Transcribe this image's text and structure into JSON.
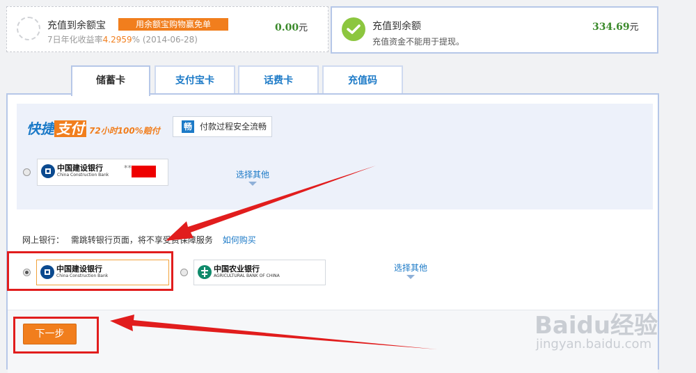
{
  "yuebao_card": {
    "title": "充值到余额宝",
    "promo": "用余额宝购物赢免单",
    "rate_prefix": "7日年化收益率",
    "rate_value": "4.2959",
    "rate_suffix": "% (2014-06-28)",
    "amount": "0.00",
    "unit": "元"
  },
  "balance_card": {
    "title": "充值到余额",
    "subtitle": "充值资金不能用于提现。",
    "amount": "334.69",
    "unit": "元"
  },
  "tabs": [
    {
      "label": "储蓄卡",
      "active": true
    },
    {
      "label": "支付宝卡",
      "active": false
    },
    {
      "label": "话费卡",
      "active": false
    },
    {
      "label": "充值码",
      "active": false
    }
  ],
  "quick_pay": {
    "brand_a": "快捷",
    "brand_b": "支付",
    "guarantee": "72小时100%赔付",
    "secure_icon": "畅",
    "secure_text": "付款过程安全流畅",
    "bank_name": "中国建设银行",
    "bank_en": "China Construction Bank",
    "card_masked": "**",
    "select_other": "选择其他"
  },
  "net_bank": {
    "label": "网上银行：",
    "note": "需跳转银行页面，将不享受",
    "note_tail": "费保障服务",
    "how_buy": "如何购买",
    "banks": [
      {
        "name": "中国建设银行",
        "en": "China Construction Bank",
        "selected": true
      },
      {
        "name": "中国农业银行",
        "en": "AGRICULTURAL BANK OF CHINA",
        "selected": false
      }
    ],
    "select_other": "选择其他"
  },
  "next_button": "下一步",
  "watermark": {
    "text": "Baidu经验",
    "url": "jingyan.baidu.com"
  },
  "colors": {
    "accent_orange": "#f17e1d",
    "link_blue": "#1c7ac7",
    "amount_green": "#3b8a2c",
    "annotation_red": "#e11d1d"
  }
}
